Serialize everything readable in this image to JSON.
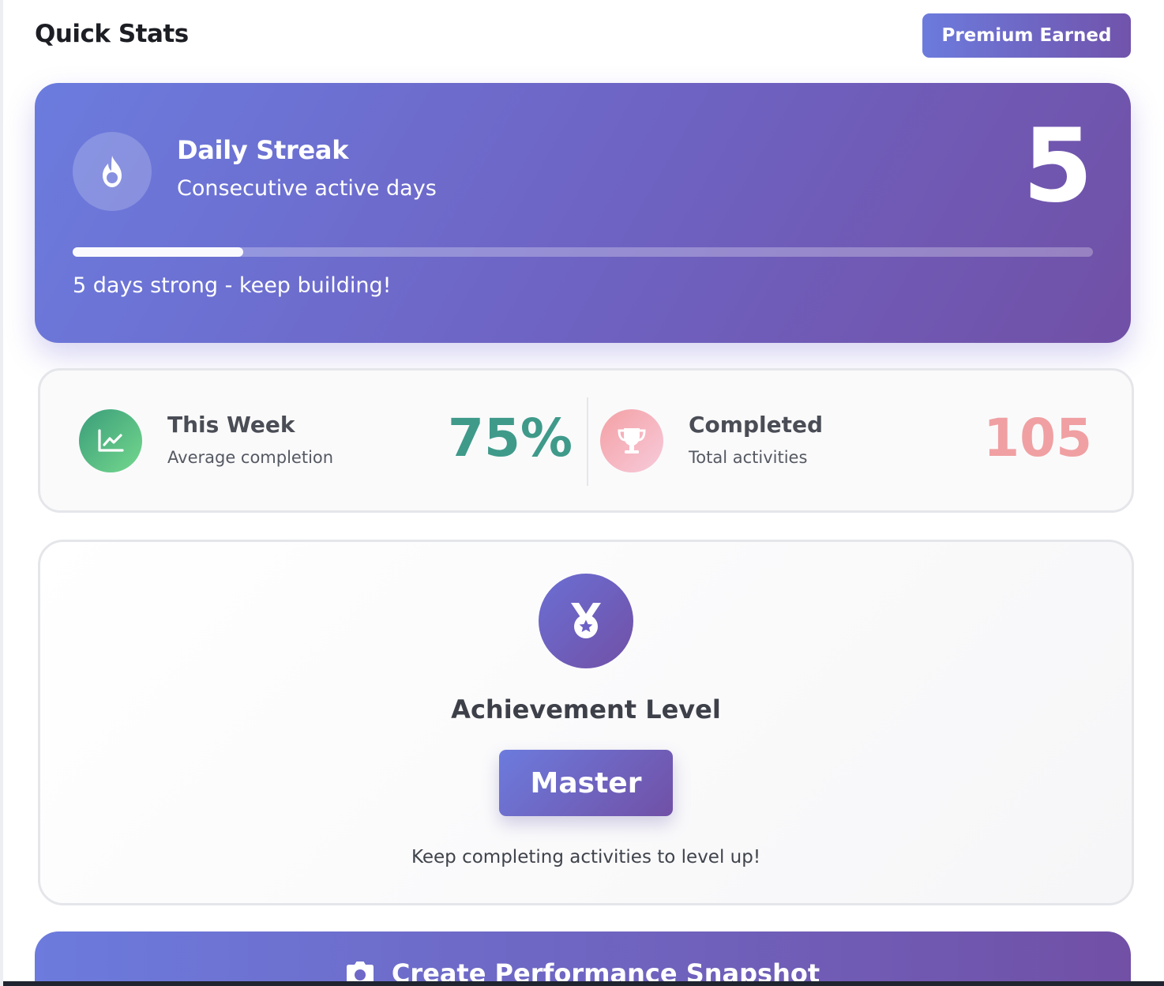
{
  "header": {
    "title": "Quick Stats",
    "badge": "Premium Earned"
  },
  "streak": {
    "icon": "fire-icon",
    "title": "Daily Streak",
    "subtitle": "Consecutive active days",
    "value": "5",
    "progress_fraction": 0.167,
    "message": "5 days strong - keep building!"
  },
  "stats": {
    "week": {
      "icon": "chart-line-icon",
      "label": "This Week",
      "sublabel": "Average completion",
      "value": "75%"
    },
    "completed": {
      "icon": "trophy-icon",
      "label": "Completed",
      "sublabel": "Total activities",
      "value": "105"
    }
  },
  "achievement": {
    "icon": "medal-icon",
    "title": "Achievement Level",
    "level": "Master",
    "hint": "Keep completing activities to level up!"
  },
  "snapshot": {
    "icon": "camera-icon",
    "label": "Create Performance Snapshot"
  },
  "colors": {
    "accent_start": "#6c7bdd",
    "accent_end": "#7150a6",
    "week_value": "#3f9a8a",
    "completed_value": "#f0a0a2"
  }
}
